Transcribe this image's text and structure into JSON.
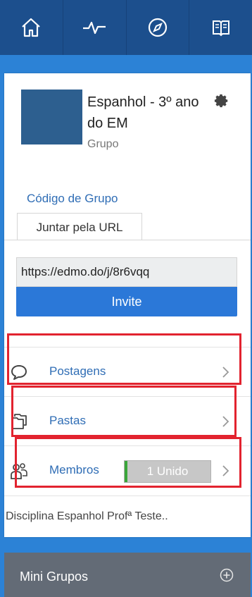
{
  "nav": {
    "items": [
      {
        "icon": "home-icon"
      },
      {
        "icon": "activity-icon"
      },
      {
        "icon": "compass-icon"
      },
      {
        "icon": "book-icon"
      }
    ]
  },
  "group": {
    "title": "Espanhol - 3º ano do EM",
    "subtitle": "Grupo",
    "code_link": "Código de Grupo",
    "url_tab": "Juntar pela URL",
    "url_value": "https://edmo.do/j/8r6vqq",
    "invite_label": "Invite"
  },
  "rows": {
    "posts": {
      "label": "Postagens"
    },
    "folders": {
      "label": "Pastas"
    },
    "members": {
      "label": "Membros",
      "badge": "1 Unido",
      "progress": 0.03
    }
  },
  "description": "Disciplina Espanhol Profª Teste..",
  "mini_groups": {
    "label": "Mini Grupos"
  },
  "colors": {
    "nav_bg": "#1c4f8d",
    "page_bg": "#2c82d6",
    "link": "#2f6db5",
    "button": "#2b78d8",
    "highlight": "#e2232f"
  }
}
